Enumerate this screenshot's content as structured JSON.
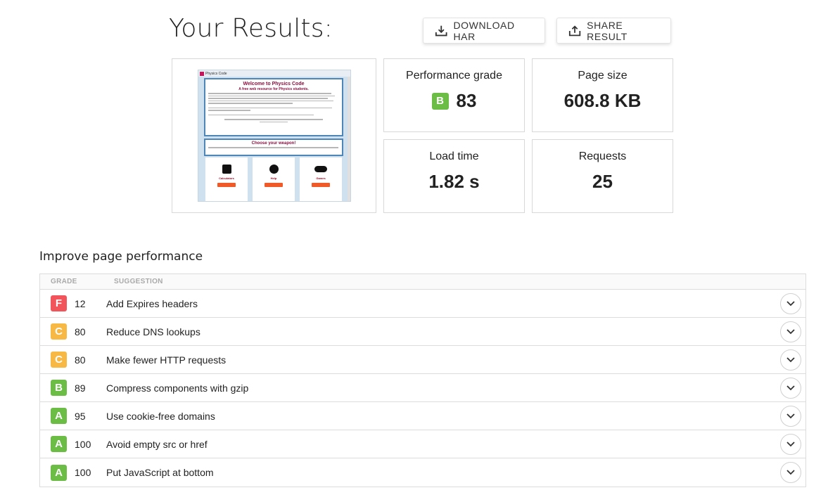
{
  "header": {
    "title": "Your Results:",
    "download_label": "DOWNLOAD HAR",
    "share_label": "SHARE RESULT"
  },
  "screenshot": {
    "tab_title": "Physics Code",
    "welcome_title": "Welcome to Physics Code",
    "welcome_subtitle": "A free web resource for Physics students.",
    "weapon_title": "Choose your weapon!",
    "col1": "Calculators",
    "col2": "Help",
    "col3": "Games"
  },
  "metrics": {
    "performance_label": "Performance grade",
    "performance_grade": "B",
    "performance_score": "83",
    "page_size_label": "Page size",
    "page_size": "608.8 KB",
    "load_time_label": "Load time",
    "load_time": "1.82 s",
    "requests_label": "Requests",
    "requests": "25"
  },
  "improve": {
    "title": "Improve page performance",
    "col_grade": "GRADE",
    "col_suggestion": "SUGGESTION",
    "rows": [
      {
        "grade": "F",
        "score": "12",
        "suggestion": "Add Expires headers",
        "color": "#f2545b"
      },
      {
        "grade": "C",
        "score": "80",
        "suggestion": "Reduce DNS lookups",
        "color": "#f7b844"
      },
      {
        "grade": "C",
        "score": "80",
        "suggestion": "Make fewer HTTP requests",
        "color": "#f7b844"
      },
      {
        "grade": "B",
        "score": "89",
        "suggestion": "Compress components with gzip",
        "color": "#6cbd45"
      },
      {
        "grade": "A",
        "score": "95",
        "suggestion": "Use cookie-free domains",
        "color": "#6cbd45"
      },
      {
        "grade": "A",
        "score": "100",
        "suggestion": "Avoid empty src or href",
        "color": "#6cbd45"
      },
      {
        "grade": "A",
        "score": "100",
        "suggestion": "Put JavaScript at bottom",
        "color": "#6cbd45"
      }
    ]
  }
}
